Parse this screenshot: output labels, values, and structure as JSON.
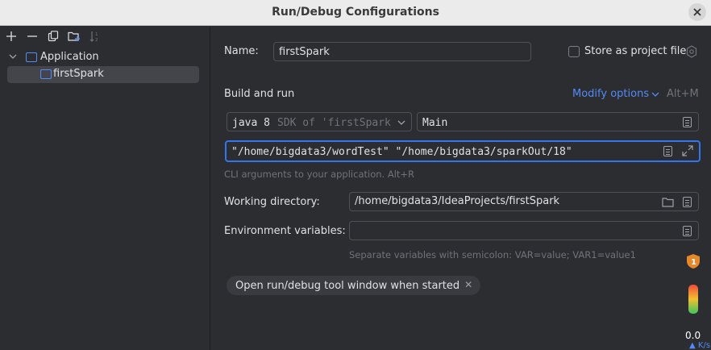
{
  "window": {
    "title": "Run/Debug Configurations"
  },
  "toolbar": {
    "add_icon": "plus-icon",
    "remove_icon": "minus-icon",
    "copy_icon": "copy-icon",
    "folder_icon": "new-folder-icon",
    "sort_icon": "sort-icon"
  },
  "tree": {
    "group_label": "Application",
    "item_label": "firstSpark"
  },
  "form": {
    "name_label": "Name:",
    "name_value": "firstSpark",
    "store_label": "Store as project file",
    "build_run_label": "Build and run",
    "modify_options_label": "Modify options",
    "modify_shortcut": "Alt+M",
    "sdk_java": "java 8",
    "sdk_detail": "SDK of 'firstSpark",
    "main_class": "Main",
    "program_args": "\"/home/bigdata3/wordTest\"   \"/home/bigdata3/sparkOut/18\"",
    "args_hint": "CLI arguments to your application. Alt+R",
    "workdir_label": "Working directory:",
    "workdir_value": "/home/bigdata3/IdeaProjects/firstSpark",
    "env_label": "Environment variables:",
    "env_value": "",
    "env_hint": "Separate variables with semicolon: VAR=value; VAR1=value1",
    "chip_label": "Open run/debug tool window when started"
  },
  "side": {
    "badge_count": "1",
    "rate_value": "0.0",
    "rate_unit": "K/s"
  },
  "colors": {
    "accent": "#548af7",
    "focus_border": "#3574f0",
    "background": "#2b2d30"
  }
}
